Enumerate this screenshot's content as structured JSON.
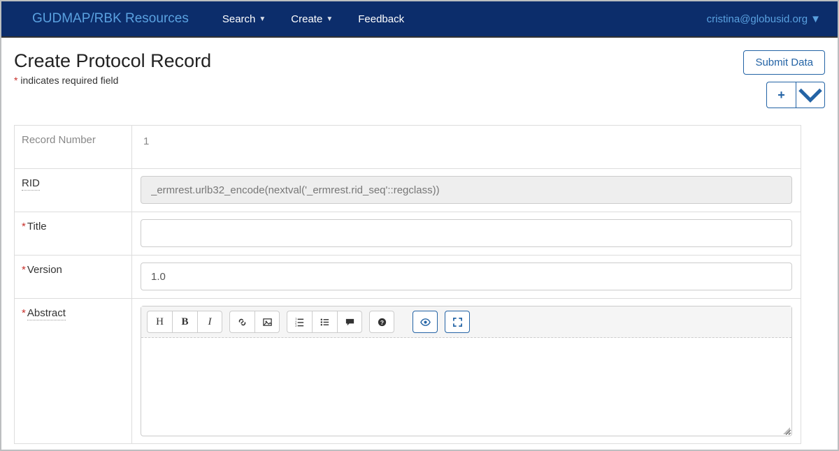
{
  "navbar": {
    "brand": "GUDMAP/RBK Resources",
    "items": [
      {
        "label": "Search",
        "dropdown": true
      },
      {
        "label": "Create",
        "dropdown": true
      },
      {
        "label": "Feedback",
        "dropdown": false
      }
    ],
    "user": "cristina@globusid.org"
  },
  "header": {
    "title": "Create Protocol Record",
    "required_note_prefix": "*",
    "required_note": " indicates required field",
    "submit_label": "Submit Data"
  },
  "form": {
    "rows": [
      {
        "key": "record_number",
        "label": "Record Number",
        "required": false,
        "type": "static",
        "value": "1",
        "underlined": false,
        "muted": true
      },
      {
        "key": "rid",
        "label": "RID",
        "required": false,
        "type": "readonly",
        "value": "_ermrest.urlb32_encode(nextval('_ermrest.rid_seq'::regclass))",
        "underlined": true,
        "muted": false
      },
      {
        "key": "title",
        "label": "Title",
        "required": true,
        "type": "text",
        "value": "",
        "underlined": false,
        "muted": false
      },
      {
        "key": "version",
        "label": "Version",
        "required": true,
        "type": "text",
        "value": "1.0",
        "underlined": false,
        "muted": false
      },
      {
        "key": "abstract",
        "label": "Abstract",
        "required": true,
        "type": "editor",
        "value": "",
        "underlined": true,
        "muted": false
      }
    ]
  },
  "editor_toolbar": {
    "groups": [
      [
        "heading",
        "bold",
        "italic"
      ],
      [
        "link",
        "image"
      ],
      [
        "ol",
        "ul",
        "comment"
      ],
      [
        "help"
      ]
    ],
    "right": [
      "preview",
      "fullscreen"
    ]
  },
  "icons": {
    "heading": "H",
    "bold": "B",
    "italic": "I"
  }
}
